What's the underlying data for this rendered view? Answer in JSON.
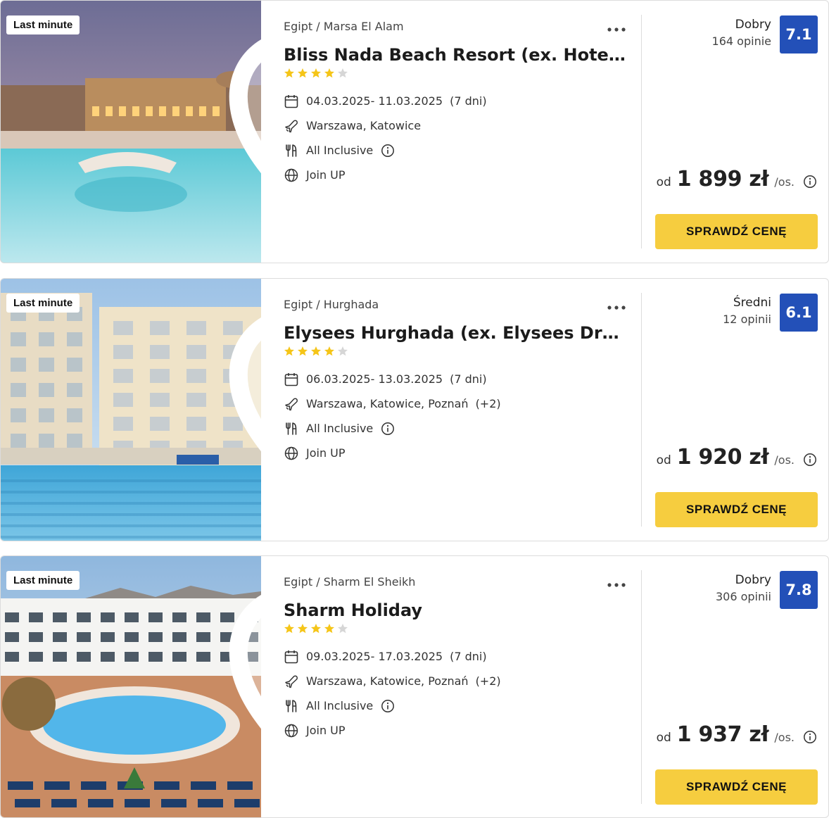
{
  "offers": [
    {
      "badge": "Last minute",
      "location": "Egipt / Marsa El Alam",
      "name": "Bliss Nada Beach Resort (ex. Hotelux Marsa Alam)",
      "stars": 4,
      "dates": "04.03.2025- 11.03.2025",
      "duration": "(7 dni)",
      "departures": "Warszawa, Katowice",
      "departures_extra": "",
      "board": "All Inclusive",
      "operator": "Join UP",
      "rating_label": "Dobry",
      "rating_count": "164 opinie",
      "score": "7.1",
      "price_prefix": "od",
      "price": "1 899 zł",
      "price_unit": "/os.",
      "cta": "SPRAWDŹ CENĘ",
      "photo_theme": "pool-evening"
    },
    {
      "badge": "Last minute",
      "location": "Egipt / Hurghada",
      "name": "Elysees Hurghada (ex. Elysees Dream Beach)",
      "stars": 4,
      "dates": "06.03.2025- 13.03.2025",
      "duration": "(7 dni)",
      "departures": "Warszawa, Katowice, Poznań",
      "departures_extra": "(+2)",
      "board": "All Inclusive",
      "operator": "Join UP",
      "rating_label": "Średni",
      "rating_count": "12 opinii",
      "score": "6.1",
      "price_prefix": "od",
      "price": "1 920 zł",
      "price_unit": "/os.",
      "cta": "SPRAWDŹ CENĘ",
      "photo_theme": "pool-building"
    },
    {
      "badge": "Last minute",
      "location": "Egipt / Sharm El Sheikh",
      "name": "Sharm Holiday",
      "stars": 4,
      "dates": "09.03.2025- 17.03.2025",
      "duration": "(7 dni)",
      "departures": "Warszawa, Katowice, Poznań",
      "departures_extra": "(+2)",
      "board": "All Inclusive",
      "operator": "Join UP",
      "rating_label": "Dobry",
      "rating_count": "306 opinii",
      "score": "7.8",
      "price_prefix": "od",
      "price": "1 937 zł",
      "price_unit": "/os.",
      "cta": "SPRAWDŹ CENĘ",
      "photo_theme": "pool-aerial"
    }
  ],
  "colors": {
    "score_bg": "#2350b8",
    "cta_bg": "#f6cd3f",
    "star_on": "#f5c518",
    "star_off": "#d6d6d6"
  },
  "icons": {
    "favorite": "heart-icon",
    "more": "more-dots-icon",
    "dates": "calendar-icon",
    "departures": "plane-icon",
    "board": "cutlery-icon",
    "operator": "globe-icon",
    "info": "info-icon"
  }
}
